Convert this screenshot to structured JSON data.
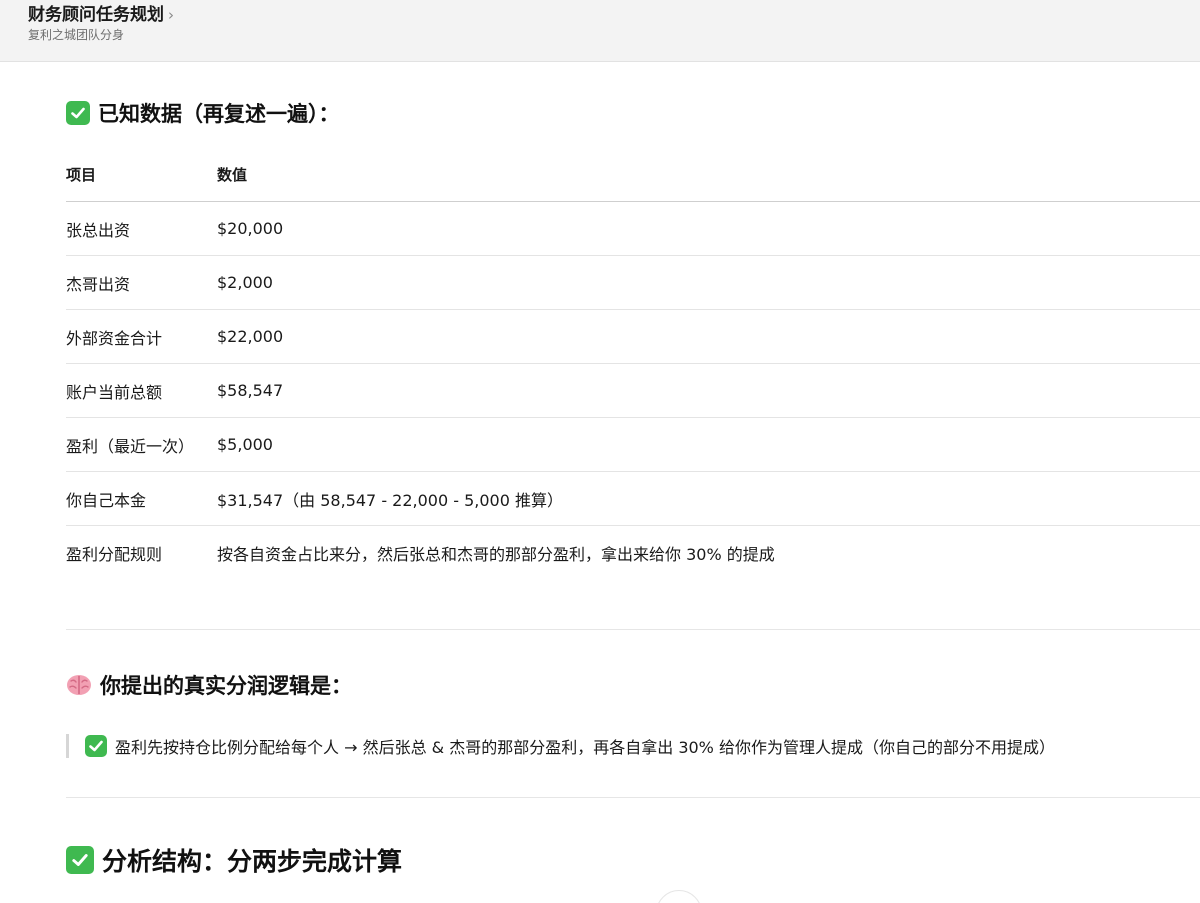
{
  "header": {
    "title": "财务顾问任务规划",
    "subtitle": "复利之城团队分身"
  },
  "known_data": {
    "heading": "已知数据（再复述一遍）：",
    "columns": [
      "项目",
      "数值"
    ],
    "rows": [
      {
        "item": "张总出资",
        "value": "$20,000"
      },
      {
        "item": "杰哥出资",
        "value": "$2,000"
      },
      {
        "item": "外部资金合计",
        "value": "$22,000"
      },
      {
        "item": "账户当前总额",
        "value": "$58,547"
      },
      {
        "item": "盈利（最近一次）",
        "value": "$5,000"
      },
      {
        "item": "你自己本金",
        "value": "$31,547（由 58,547 - 22,000 - 5,000 推算）"
      },
      {
        "item": "盈利分配规则",
        "value": "按各自资金占比来分，然后张总和杰哥的那部分盈利，拿出来给你 30% 的提成"
      }
    ]
  },
  "logic": {
    "heading": "你提出的真实分润逻辑是：",
    "quote": "盈利先按持仓比例分配给每个人 → 然后张总 & 杰哥的那部分盈利，再各自拿出 30% 给你作为管理人提成（你自己的部分不用提成）"
  },
  "analysis": {
    "heading": "分析结构：分两步完成计算"
  },
  "colors": {
    "check_green": "#3fb950",
    "header_bg": "#f3f3f3"
  }
}
